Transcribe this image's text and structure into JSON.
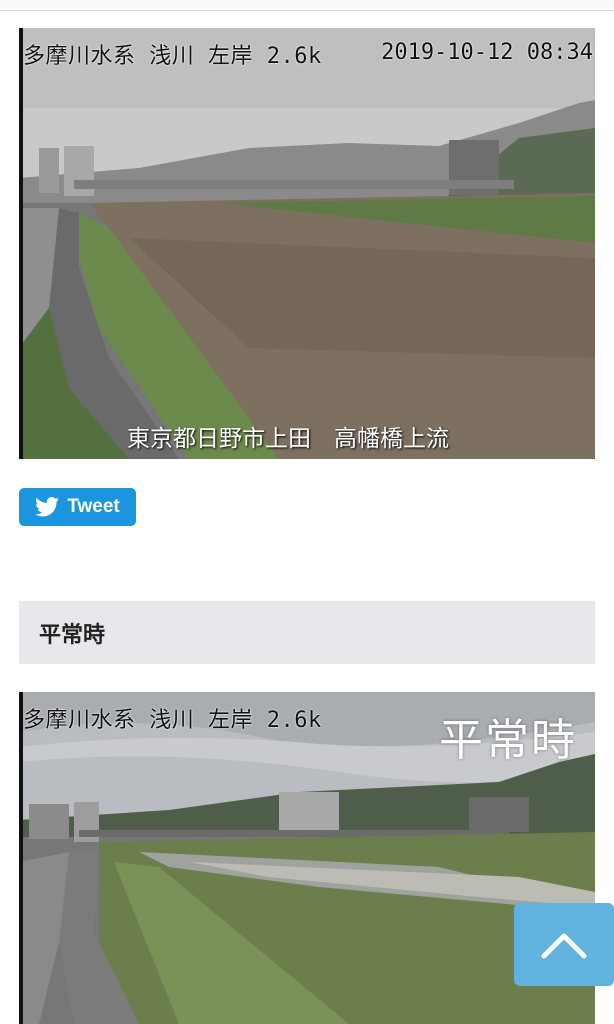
{
  "camera1": {
    "label": "多摩川水系 浅川 左岸 2.6k",
    "timestamp": "2019-10-12 08:34",
    "caption": "東京都日野市上田　高幡橋上流"
  },
  "tweet": {
    "label": "Tweet",
    "icon": "twitter-bird-icon",
    "color": "#1b95e0"
  },
  "section": {
    "title": "平常時"
  },
  "camera2": {
    "label": "多摩川水系 浅川 左岸 2.6k",
    "overlay": "平常時"
  },
  "back_to_top": {
    "icon": "chevron-up-icon",
    "color": "#5fb3dc"
  }
}
